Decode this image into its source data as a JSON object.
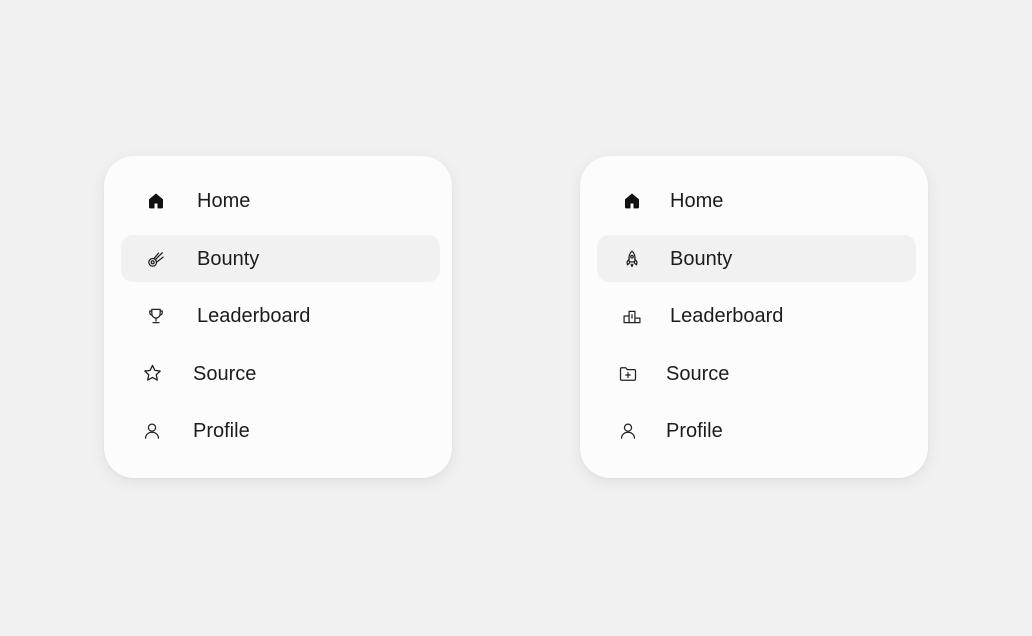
{
  "menus": [
    {
      "id": "left",
      "items": [
        {
          "label": "Home",
          "icon": "home-icon",
          "active": false
        },
        {
          "label": "Bounty",
          "icon": "comet-icon",
          "active": true
        },
        {
          "label": "Leaderboard",
          "icon": "trophy-icon",
          "active": false
        },
        {
          "label": "Source",
          "icon": "star-icon",
          "active": false
        },
        {
          "label": "Profile",
          "icon": "user-icon",
          "active": false
        }
      ]
    },
    {
      "id": "right",
      "items": [
        {
          "label": "Home",
          "icon": "home-icon",
          "active": false
        },
        {
          "label": "Bounty",
          "icon": "rocket-icon",
          "active": true
        },
        {
          "label": "Leaderboard",
          "icon": "podium-icon",
          "active": false
        },
        {
          "label": "Source",
          "icon": "folder-plus-icon",
          "active": false
        },
        {
          "label": "Profile",
          "icon": "user-icon",
          "active": false
        }
      ]
    }
  ],
  "colors": {
    "background": "#f1f1f1",
    "card": "#fcfcfc",
    "active_item": "#f1f1f1",
    "text": "#1c1c1c"
  }
}
